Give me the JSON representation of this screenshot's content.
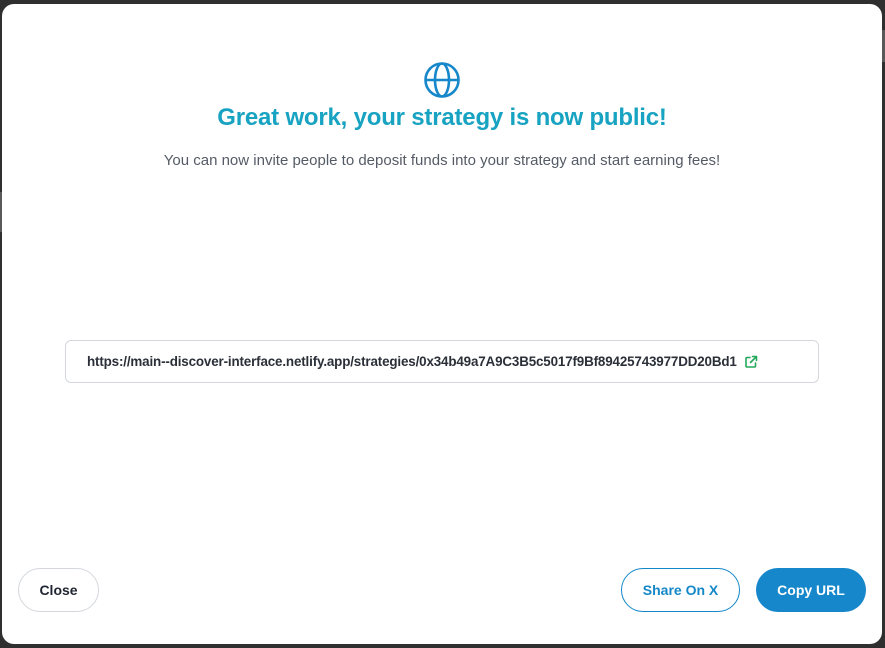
{
  "modal": {
    "title": "Great work, your strategy is now public!",
    "subtitle": "You can now invite people to deposit funds into your strategy and start earning fees!",
    "url": "https://main--discover-interface.netlify.app/strategies/0x34b49a7A9C3B5c5017f9Bf89425743977DD20Bd1",
    "icons": {
      "header": "globe-icon",
      "url_action": "external-link-icon"
    }
  },
  "actions": {
    "close_label": "Close",
    "share_label": "Share On X",
    "copy_label": "Copy URL"
  },
  "colors": {
    "title": "#17a3c1",
    "primary": "#1687cb",
    "external_link": "#22a85a"
  }
}
